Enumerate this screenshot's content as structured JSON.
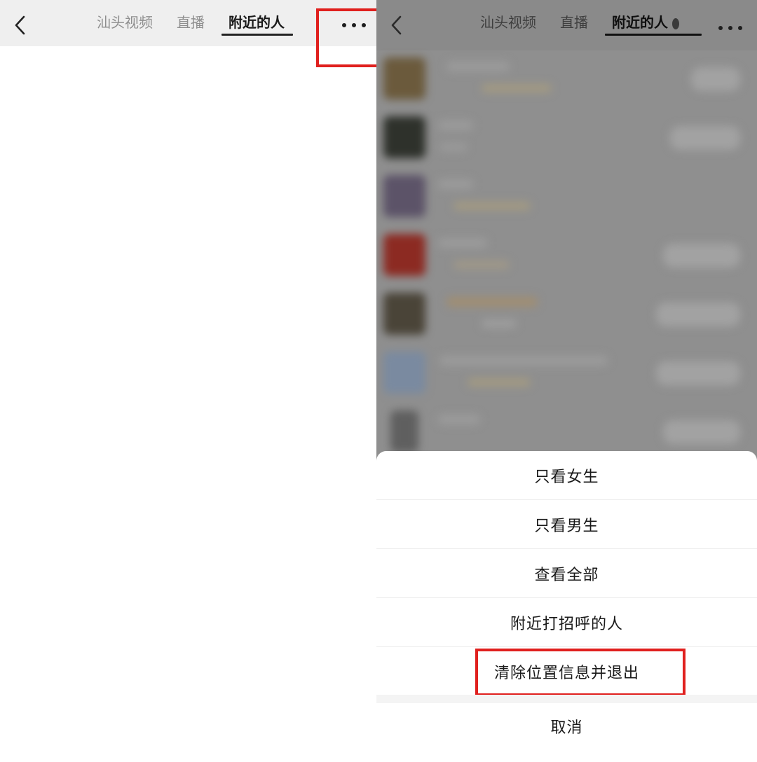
{
  "left_panel": {
    "tabs": [
      {
        "label": "汕头视频",
        "active": false
      },
      {
        "label": "直播",
        "active": false
      },
      {
        "label": "附近的人",
        "active": true
      }
    ]
  },
  "right_panel": {
    "tabs": [
      {
        "label": "汕头视频",
        "active": false
      },
      {
        "label": "直播",
        "active": false
      },
      {
        "label": "附近的人",
        "active": true
      }
    ],
    "sheet": {
      "items": [
        {
          "label": "只看女生"
        },
        {
          "label": "只看男生"
        },
        {
          "label": "查看全部"
        },
        {
          "label": "附近打招呼的人"
        },
        {
          "label": "清除位置信息并退出"
        }
      ],
      "cancel_label": "取消"
    }
  },
  "colors": {
    "highlight": "#e0201e",
    "overlay": "#8f8f8f"
  }
}
